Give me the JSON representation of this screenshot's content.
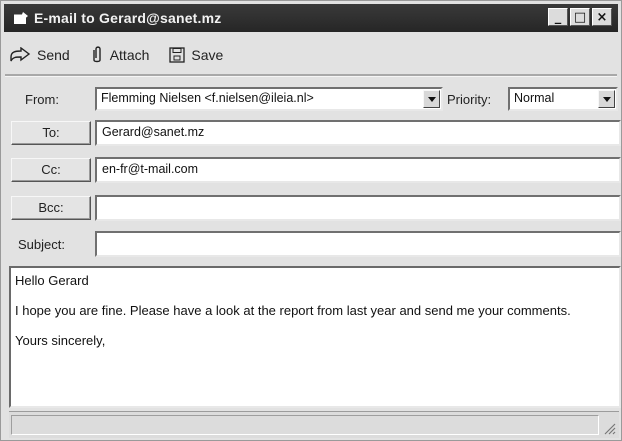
{
  "window": {
    "title": "E-mail to Gerard@sanet.mz",
    "controls": [
      "_",
      "□",
      "×"
    ]
  },
  "toolbar": {
    "send_label": "Send",
    "attach_label": "Attach",
    "save_label": "Save"
  },
  "header": {
    "from_label": "From:",
    "from_value": "Flemming Nielsen <f.nielsen@ileia.nl>",
    "priority_label": "Priority:",
    "priority_value": "Normal",
    "to_label": "To:",
    "to_value": "Gerard@sanet.mz",
    "cc_label": "Cc:",
    "cc_value": "en-fr@t-mail.com",
    "bcc_label": "Bcc:",
    "bcc_value": "",
    "subject_label": "Subject:",
    "subject_value": ""
  },
  "body": {
    "greeting": "Hello Gerard",
    "paragraph": "I hope you are fine. Please have a look at the report from last year and send  me your comments.",
    "closing": "Yours sincerely,"
  },
  "icons": [
    "mail-icon",
    "send-icon",
    "attach-icon",
    "save-icon",
    "dropdown-arrow-icon",
    "resize-grip-icon"
  ]
}
